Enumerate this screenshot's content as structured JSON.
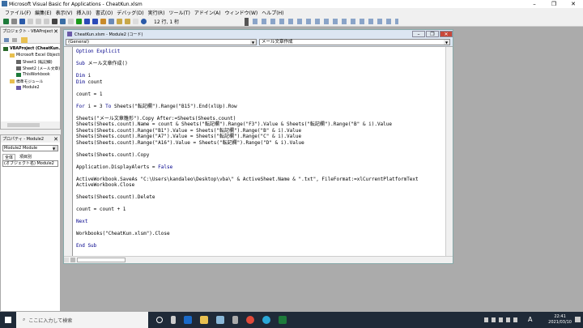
{
  "window": {
    "title": "Microsoft Visual Basic for Applications - CheatKun.xlsm"
  },
  "menu": [
    "ファイル(F)",
    "編集(E)",
    "表示(V)",
    "挿入(I)",
    "書式(O)",
    "デバッグ(D)",
    "実行(R)",
    "ツール(T)",
    "アドイン(A)",
    "ウィンドウ(W)",
    "ヘルプ(H)"
  ],
  "toolbar": {
    "position": "12 行, 1 桁"
  },
  "project": {
    "title": "プロジェクト - VBAProject",
    "tree": [
      {
        "label": "VBAProject (CheatKun.xlsm)",
        "level": 0
      },
      {
        "label": "Microsoft Excel Objects",
        "level": 1
      },
      {
        "label": "Sheet1 (転記欄)",
        "level": 2
      },
      {
        "label": "Sheet2 (メール文章)",
        "level": 2
      },
      {
        "label": "ThisWorkbook",
        "level": 2
      },
      {
        "label": "標準モジュール",
        "level": 1
      },
      {
        "label": "Module2",
        "level": 2
      }
    ]
  },
  "properties": {
    "title": "プロパティ - Module2",
    "object": "Module2 Module",
    "tabs": [
      "全体",
      "項目別"
    ],
    "row": "(オブジェクト名)  Module2"
  },
  "code_window": {
    "title": "CheatKun.xlsm - Module2 (コード)",
    "object_combo": "(General)",
    "proc_combo": "メール文章作成",
    "lines": [
      [
        [
          "Option Explicit",
          "k"
        ]
      ],
      [],
      [
        [
          "Sub ",
          "k"
        ],
        [
          "メール文章作成()",
          ""
        ]
      ],
      [],
      [
        [
          "Dim ",
          "k"
        ],
        [
          "i",
          ""
        ]
      ],
      [
        [
          "Dim ",
          "k"
        ],
        [
          "count",
          ""
        ]
      ],
      [],
      [
        [
          "count = 1",
          ""
        ]
      ],
      [],
      [
        [
          "For ",
          "k"
        ],
        [
          "i = 3 ",
          ""
        ],
        [
          "To ",
          "k"
        ],
        [
          "Sheets(\"転記欄\").Range(\"B15\").End(xlUp).Row",
          ""
        ]
      ],
      [],
      [
        [
          "Sheets(\"メール文章雛形\").Copy After:=Sheets(Sheets.count)",
          ""
        ]
      ],
      [
        [
          "Sheets(Sheets.count).Name = count & Sheets(\"転記欄\").Range(\"F3\").Value & Sheets(\"転記欄\").Range(\"B\" & i).Value",
          ""
        ]
      ],
      [
        [
          "Sheets(Sheets.count).Range(\"B1\").Value = Sheets(\"転記欄\").Range(\"B\" & i).Value",
          ""
        ]
      ],
      [
        [
          "Sheets(Sheets.count).Range(\"A7\").Value = Sheets(\"転記欄\").Range(\"C\" & i).Value",
          ""
        ]
      ],
      [
        [
          "Sheets(Sheets.count).Range(\"A16\").Value = Sheets(\"転記欄\").Range(\"D\" & i).Value",
          ""
        ]
      ],
      [],
      [
        [
          "Sheets(Sheets.count).Copy",
          ""
        ]
      ],
      [],
      [
        [
          "Application.DisplayAlerts = ",
          ""
        ],
        [
          "False",
          "k"
        ]
      ],
      [],
      [
        [
          "ActiveWorkbook.SaveAs \"C:\\Users\\kandaleo\\Desktop\\vba\\\" & ActiveSheet.Name & \".txt\", FileFormat:=xlCurrentPlatformText",
          ""
        ]
      ],
      [
        [
          "ActiveWorkbook.Close",
          ""
        ]
      ],
      [],
      [
        [
          "Sheets(Sheets.count).Delete",
          ""
        ]
      ],
      [],
      [
        [
          "count = count + 1",
          ""
        ]
      ],
      [],
      [
        [
          "Next",
          "k"
        ]
      ],
      [],
      [
        [
          "Workbooks(\"CheatKun.xlsm\").Close",
          ""
        ]
      ],
      [],
      [
        [
          "End Sub",
          "k"
        ]
      ]
    ]
  },
  "taskbar": {
    "search_placeholder": "ここに入力して検索",
    "time": "22:41",
    "date": "2021/03/10",
    "ime": "A"
  }
}
